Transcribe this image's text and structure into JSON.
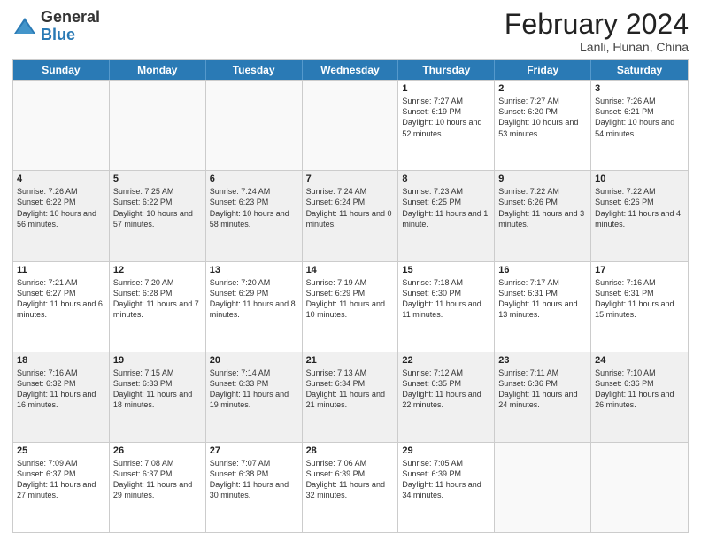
{
  "header": {
    "logo_general": "General",
    "logo_blue": "Blue",
    "title": "February 2024",
    "subtitle": "Lanli, Hunan, China"
  },
  "days_of_week": [
    "Sunday",
    "Monday",
    "Tuesday",
    "Wednesday",
    "Thursday",
    "Friday",
    "Saturday"
  ],
  "weeks": [
    [
      {
        "day": "",
        "info": "",
        "empty": true
      },
      {
        "day": "",
        "info": "",
        "empty": true
      },
      {
        "day": "",
        "info": "",
        "empty": true
      },
      {
        "day": "",
        "info": "",
        "empty": true
      },
      {
        "day": "1",
        "info": "Sunrise: 7:27 AM\nSunset: 6:19 PM\nDaylight: 10 hours and 52 minutes."
      },
      {
        "day": "2",
        "info": "Sunrise: 7:27 AM\nSunset: 6:20 PM\nDaylight: 10 hours and 53 minutes."
      },
      {
        "day": "3",
        "info": "Sunrise: 7:26 AM\nSunset: 6:21 PM\nDaylight: 10 hours and 54 minutes."
      }
    ],
    [
      {
        "day": "4",
        "info": "Sunrise: 7:26 AM\nSunset: 6:22 PM\nDaylight: 10 hours and 56 minutes.",
        "shaded": true
      },
      {
        "day": "5",
        "info": "Sunrise: 7:25 AM\nSunset: 6:22 PM\nDaylight: 10 hours and 57 minutes.",
        "shaded": true
      },
      {
        "day": "6",
        "info": "Sunrise: 7:24 AM\nSunset: 6:23 PM\nDaylight: 10 hours and 58 minutes.",
        "shaded": true
      },
      {
        "day": "7",
        "info": "Sunrise: 7:24 AM\nSunset: 6:24 PM\nDaylight: 11 hours and 0 minutes.",
        "shaded": true
      },
      {
        "day": "8",
        "info": "Sunrise: 7:23 AM\nSunset: 6:25 PM\nDaylight: 11 hours and 1 minute.",
        "shaded": true
      },
      {
        "day": "9",
        "info": "Sunrise: 7:22 AM\nSunset: 6:26 PM\nDaylight: 11 hours and 3 minutes.",
        "shaded": true
      },
      {
        "day": "10",
        "info": "Sunrise: 7:22 AM\nSunset: 6:26 PM\nDaylight: 11 hours and 4 minutes.",
        "shaded": true
      }
    ],
    [
      {
        "day": "11",
        "info": "Sunrise: 7:21 AM\nSunset: 6:27 PM\nDaylight: 11 hours and 6 minutes."
      },
      {
        "day": "12",
        "info": "Sunrise: 7:20 AM\nSunset: 6:28 PM\nDaylight: 11 hours and 7 minutes."
      },
      {
        "day": "13",
        "info": "Sunrise: 7:20 AM\nSunset: 6:29 PM\nDaylight: 11 hours and 8 minutes."
      },
      {
        "day": "14",
        "info": "Sunrise: 7:19 AM\nSunset: 6:29 PM\nDaylight: 11 hours and 10 minutes."
      },
      {
        "day": "15",
        "info": "Sunrise: 7:18 AM\nSunset: 6:30 PM\nDaylight: 11 hours and 11 minutes."
      },
      {
        "day": "16",
        "info": "Sunrise: 7:17 AM\nSunset: 6:31 PM\nDaylight: 11 hours and 13 minutes."
      },
      {
        "day": "17",
        "info": "Sunrise: 7:16 AM\nSunset: 6:31 PM\nDaylight: 11 hours and 15 minutes."
      }
    ],
    [
      {
        "day": "18",
        "info": "Sunrise: 7:16 AM\nSunset: 6:32 PM\nDaylight: 11 hours and 16 minutes.",
        "shaded": true
      },
      {
        "day": "19",
        "info": "Sunrise: 7:15 AM\nSunset: 6:33 PM\nDaylight: 11 hours and 18 minutes.",
        "shaded": true
      },
      {
        "day": "20",
        "info": "Sunrise: 7:14 AM\nSunset: 6:33 PM\nDaylight: 11 hours and 19 minutes.",
        "shaded": true
      },
      {
        "day": "21",
        "info": "Sunrise: 7:13 AM\nSunset: 6:34 PM\nDaylight: 11 hours and 21 minutes.",
        "shaded": true
      },
      {
        "day": "22",
        "info": "Sunrise: 7:12 AM\nSunset: 6:35 PM\nDaylight: 11 hours and 22 minutes.",
        "shaded": true
      },
      {
        "day": "23",
        "info": "Sunrise: 7:11 AM\nSunset: 6:36 PM\nDaylight: 11 hours and 24 minutes.",
        "shaded": true
      },
      {
        "day": "24",
        "info": "Sunrise: 7:10 AM\nSunset: 6:36 PM\nDaylight: 11 hours and 26 minutes.",
        "shaded": true
      }
    ],
    [
      {
        "day": "25",
        "info": "Sunrise: 7:09 AM\nSunset: 6:37 PM\nDaylight: 11 hours and 27 minutes."
      },
      {
        "day": "26",
        "info": "Sunrise: 7:08 AM\nSunset: 6:37 PM\nDaylight: 11 hours and 29 minutes."
      },
      {
        "day": "27",
        "info": "Sunrise: 7:07 AM\nSunset: 6:38 PM\nDaylight: 11 hours and 30 minutes."
      },
      {
        "day": "28",
        "info": "Sunrise: 7:06 AM\nSunset: 6:39 PM\nDaylight: 11 hours and 32 minutes."
      },
      {
        "day": "29",
        "info": "Sunrise: 7:05 AM\nSunset: 6:39 PM\nDaylight: 11 hours and 34 minutes."
      },
      {
        "day": "",
        "info": "",
        "empty": true
      },
      {
        "day": "",
        "info": "",
        "empty": true
      }
    ]
  ]
}
